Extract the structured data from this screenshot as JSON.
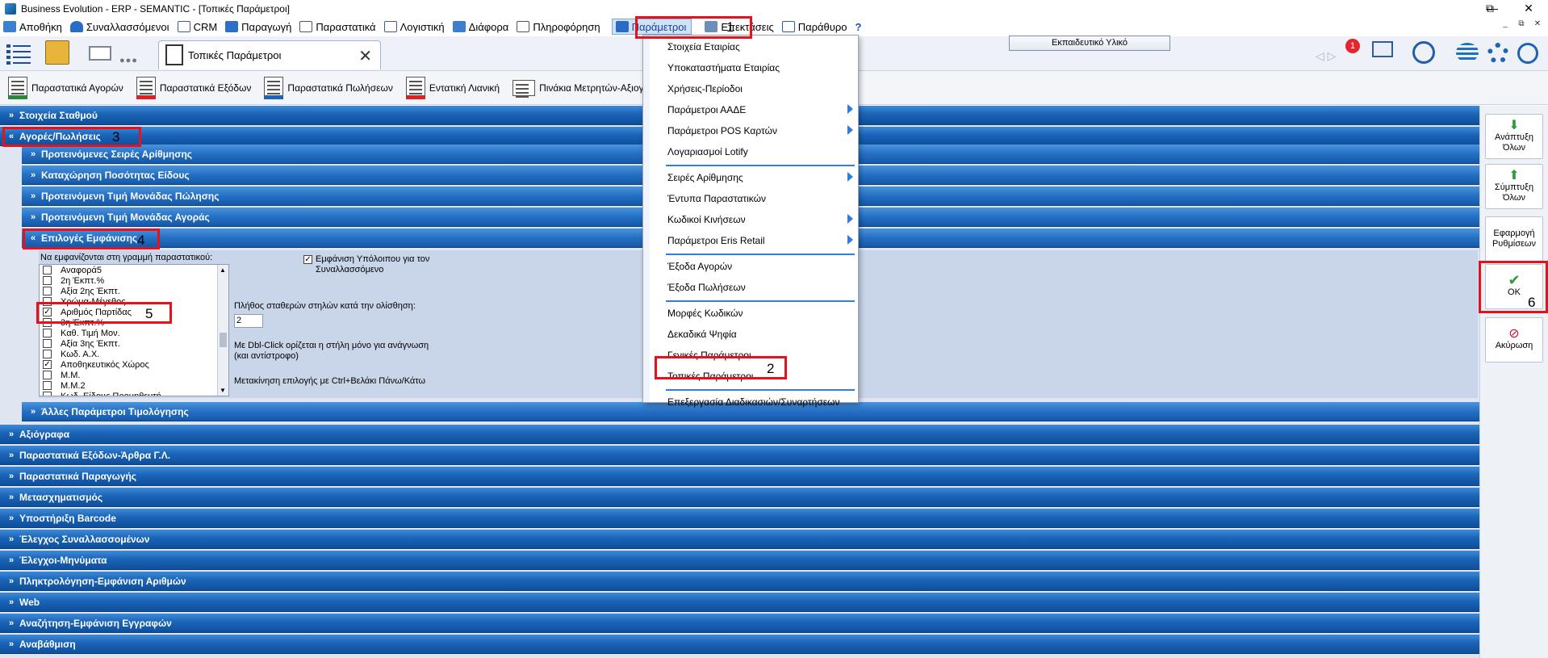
{
  "window": {
    "title": "Business Evolution - ERP - SEMANTIC - [Τοπικές Παράμετροι]",
    "min_glyph": "—",
    "max_glyph": "⧉",
    "close_glyph": "✕"
  },
  "menu": {
    "items": [
      {
        "label": "Αποθήκη",
        "icon": "warehouse-icon"
      },
      {
        "label": "Συναλλασσόμενοι",
        "icon": "user-icon"
      },
      {
        "label": "CRM",
        "icon": "crm-icon"
      },
      {
        "label": "Παραγωγή",
        "icon": "production-icon"
      },
      {
        "label": "Παραστατικά",
        "icon": "document-icon"
      },
      {
        "label": "Λογιστική",
        "icon": "accounting-icon"
      },
      {
        "label": "Διάφορα",
        "icon": "misc-icon"
      },
      {
        "label": "Πληροφόρηση",
        "icon": "info-icon"
      },
      {
        "label": "Παράμετροι",
        "icon": "parameters-icon"
      },
      {
        "label": "Επεκτάσεις",
        "icon": "extensions-icon"
      },
      {
        "label": "Παράθυρο",
        "icon": "window-icon"
      },
      {
        "label": "?",
        "icon": "help-icon"
      }
    ],
    "mdi_min": "_",
    "mdi_restore": "⧉",
    "mdi_close": "✕"
  },
  "toolbar": {
    "tab_title": "Τοπικές Παράμετροι",
    "tab_close": "✕",
    "edu_label": "Εκπαιδευτικό Υλικό",
    "notification_count": "1",
    "dots": "●●●"
  },
  "subtoolbar": [
    "Παραστατικά Αγορών",
    "Παραστατικά Εξόδων",
    "Παραστατικά Πωλήσεων",
    "Εντατική Λιανική",
    "Πινάκια Μετρητών-Αξιογρά..."
  ],
  "sections": {
    "top": [
      "Στοιχεία Σταθμού",
      "Αγορές/Πωλήσεις"
    ],
    "sub": [
      "Προτεινόμενες Σειρές Αρίθμησης",
      "Καταχώρηση Ποσότητας Είδους",
      "Προτεινόμενη Τιμή Μονάδας Πώλησης",
      "Προτεινόμενη Τιμή Μονάδας Αγοράς",
      "Επιλογές Εμφάνισης"
    ],
    "sub_after": "Άλλες Παράμετροι Τιμολόγησης",
    "bottom": [
      "Αξιόγραφα",
      "Παραστατικά Εξόδων-Άρθρα Γ.Λ.",
      "Παραστατικά Παραγωγής",
      "Μετασχηματισμός",
      "Υποστήριξη Barcode",
      "Έλεγχος Συναλλασσομένων",
      "Έλεγχοι-Μηνύματα",
      "Πληκτρολόγηση-Εμφάνιση Αριθμών",
      "Web",
      "Αναζήτηση-Εμφάνιση Εγγραφών",
      "Αναβάθμιση"
    ],
    "chevron_collapsed": "»",
    "chevron_expanded": "«"
  },
  "options": {
    "list_label": "Να εμφανίζονται στη γραμμή παραστατικού:",
    "list_items": [
      {
        "label": "Αναφορά5",
        "checked": false
      },
      {
        "label": "2η Έκπτ.%",
        "checked": false
      },
      {
        "label": "Αξία 2ης Έκπτ.",
        "checked": false
      },
      {
        "label": "Χρώμα-Μέγεθος",
        "checked": false
      },
      {
        "label": "Αριθμός Παρτίδας",
        "checked": true
      },
      {
        "label": "3η Έκπτ.%",
        "checked": false
      },
      {
        "label": "Καθ. Τιμή Μον.",
        "checked": false
      },
      {
        "label": "Αξία 3ης Έκπτ.",
        "checked": false
      },
      {
        "label": "Κωδ. Α.Χ.",
        "checked": false
      },
      {
        "label": "Αποθηκευτικός Χώρος",
        "checked": true
      },
      {
        "label": "Μ.Μ.",
        "checked": false
      },
      {
        "label": "Μ.Μ.2",
        "checked": false
      },
      {
        "label": "Κωδ. Είδους Προμηθευτή",
        "checked": false
      }
    ],
    "balance_label": "Εμφάνιση Υπόλοιπου  για τον Συναλλασσόμενο",
    "balance_checked": true,
    "fixed_cols_label": "Πλήθος σταθερών στηλών κατά την ολίσθηση:",
    "fixed_cols_value": "2",
    "dblclick_note": "Με Dbl-Click ορίζεται η στήλη μόνο για ανάγνωση (και αντίστροφο)",
    "move_note": "Μετακίνηση επιλογής με Ctrl+Βελάκι Πάνω/Κάτω"
  },
  "right_panel": {
    "expand_all": "Ανάπτυξη Όλων",
    "collapse_all": "Σύμπτυξη Όλων",
    "apply_settings": "Εφαρμογή Ρυθμίσεων",
    "ok": "OK",
    "cancel": "Ακύρωση"
  },
  "dropdown": {
    "groups": [
      [
        "Στοιχεία Εταιρίας",
        "Υποκαταστήματα Εταιρίας",
        "Χρήσεις-Περίοδοι",
        "Παράμετροι ΑΑΔΕ",
        "Παράμετροι POS Καρτών",
        "Λογαριασμοί Lotify"
      ],
      [
        "Σειρές Αρίθμησης",
        "Έντυπα Παραστατικών",
        "Κωδικοί Κινήσεων",
        "Παράμετροι Eris Retail"
      ],
      [
        "Έξοδα Αγορών",
        "Έξοδα Πωλήσεων"
      ],
      [
        "Μορφές Κωδικών",
        "Δεκαδικά Ψηφία",
        "Γενικές Παράμετροι",
        "Τοπικές Παράμετροι"
      ],
      [
        "Επεξεργασία Διαδικασιών/Συναρτήσεων"
      ]
    ],
    "submenu_items": [
      "Παράμετροι ΑΑΔΕ",
      "Παράμετροι POS Καρτών",
      "Σειρές Αρίθμησης",
      "Κωδικοί Κινήσεων",
      "Παράμετροι Eris Retail"
    ]
  },
  "annotations": [
    "1",
    "2",
    "3",
    "4",
    "5",
    "6"
  ],
  "colors": {
    "section_blue": "#1a64b8",
    "menu_active": "#cfe3f7",
    "highlight_red": "#e8101a",
    "separator_blue": "#2f7ed8"
  }
}
